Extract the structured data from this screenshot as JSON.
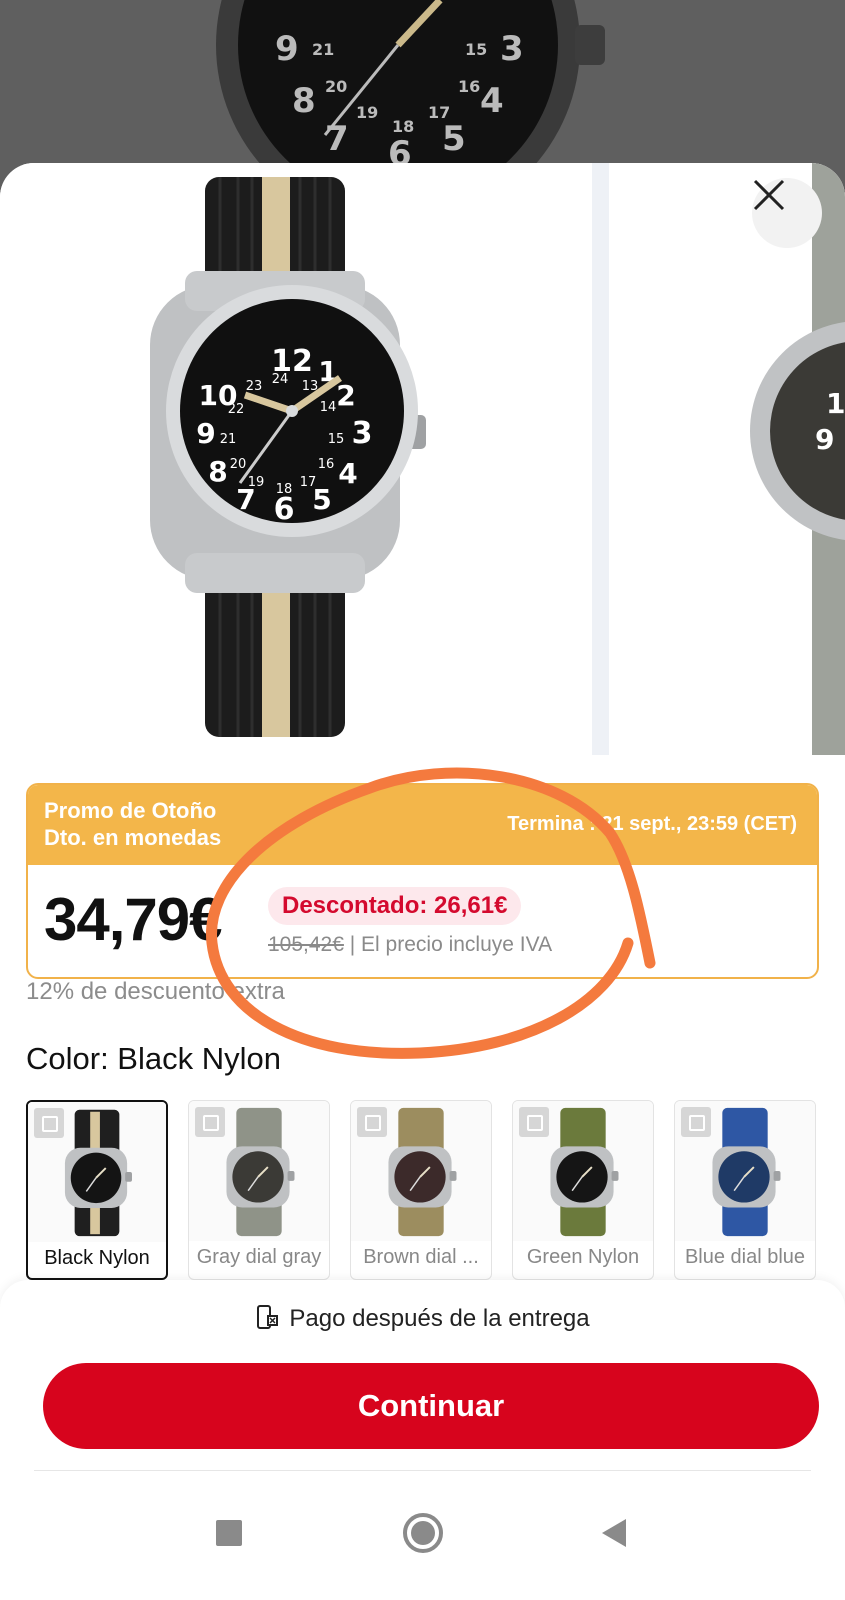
{
  "promo": {
    "title_line1": "Promo de Otoño",
    "title_line2": "Dto. en monedas",
    "ends": "Termina :  21 sept., 23:59 (CET)"
  },
  "price": {
    "current": "34,79€",
    "discount_badge": "Descontado: 26,61€",
    "original": "105,42€",
    "vat_note": " | El precio incluye IVA",
    "extra_discount": "12% de descuento extra"
  },
  "color": {
    "label": "Color: Black Nylon",
    "variants": [
      {
        "label": "Black Nylon",
        "strap": "#1f1f1f",
        "stripe": "#d8c79e",
        "dial": "#141414"
      },
      {
        "label": "Gray dial gray",
        "strap": "#8f9388",
        "stripe": "",
        "dial": "#3b3a36"
      },
      {
        "label": "Brown dial ...",
        "strap": "#9c8d5f",
        "stripe": "",
        "dial": "#3c2a2a"
      },
      {
        "label": "Green Nylon",
        "strap": "#6b7a3c",
        "stripe": "",
        "dial": "#151515"
      },
      {
        "label": "Blue dial blue",
        "strap": "#2e57a4",
        "stripe": "",
        "dial": "#1f3a66"
      }
    ]
  },
  "footer": {
    "pay_after": "Pago después de la entrega",
    "continue": "Continuar"
  },
  "colors": {
    "brand_red": "#d7041d",
    "promo_orange": "#f3b64a",
    "annotation_orange": "#f47a3e"
  },
  "icons": [
    "close-icon",
    "zoom-icon",
    "payment-icon",
    "nav-square-icon",
    "nav-circle-icon",
    "nav-back-icon"
  ]
}
